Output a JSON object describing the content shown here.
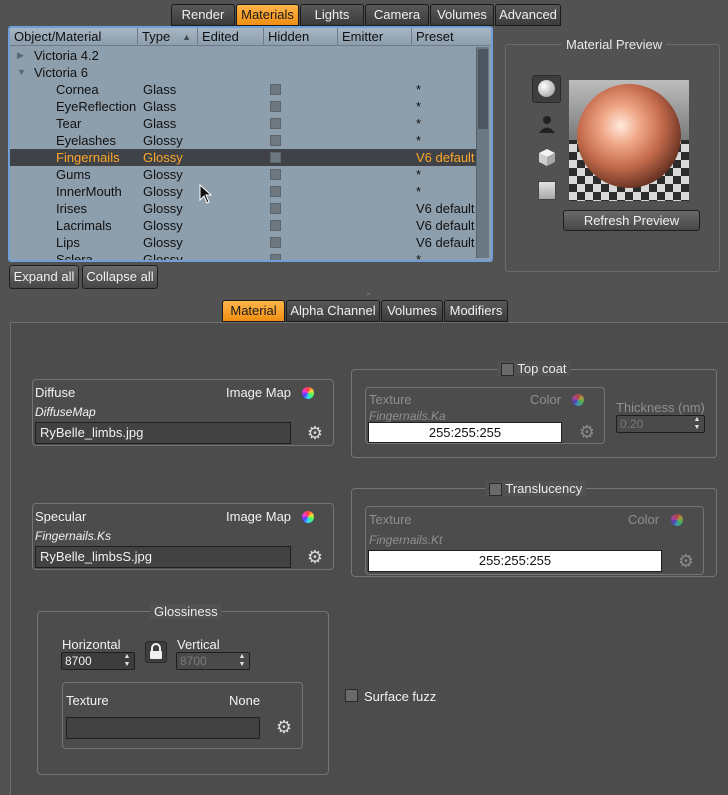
{
  "top_tabs": [
    "Render",
    "Materials",
    "Lights",
    "Camera",
    "Volumes",
    "Advanced"
  ],
  "tree": {
    "columns": [
      "Object/Material",
      "Type",
      "Edited",
      "Hidden",
      "Emitter",
      "Preset"
    ],
    "sort_indicator": "▲",
    "groups": [
      "Victoria 4.2",
      "Victoria 6"
    ],
    "rows": [
      {
        "name": "Cornea",
        "type": "Glass",
        "preset": "*"
      },
      {
        "name": "EyeReflection",
        "type": "Glass",
        "preset": "*"
      },
      {
        "name": "Tear",
        "type": "Glass",
        "preset": "*"
      },
      {
        "name": "Eyelashes",
        "type": "Glossy",
        "preset": "*"
      },
      {
        "name": "Fingernails",
        "type": "Glossy",
        "preset": "V6 default"
      },
      {
        "name": "Gums",
        "type": "Glossy",
        "preset": "*"
      },
      {
        "name": "InnerMouth",
        "type": "Glossy",
        "preset": "*"
      },
      {
        "name": "Irises",
        "type": "Glossy",
        "preset": "V6 default"
      },
      {
        "name": "Lacrimals",
        "type": "Glossy",
        "preset": "V6 default"
      },
      {
        "name": "Lips",
        "type": "Glossy",
        "preset": "V6 default"
      },
      {
        "name": "Sclera",
        "type": "Glossy",
        "preset": "*"
      }
    ]
  },
  "tree_buttons": {
    "expand": "Expand all",
    "collapse": "Collapse all"
  },
  "preview": {
    "title": "Material Preview",
    "refresh": "Refresh Preview"
  },
  "sub_tabs": [
    "Material",
    "Alpha Channel",
    "Volumes",
    "Modifiers"
  ],
  "diffuse": {
    "title": "Diffuse",
    "mode": "Image Map",
    "map_name": "DiffuseMap",
    "file": "RyBelle_limbs.jpg"
  },
  "specular": {
    "title": "Specular",
    "mode": "Image Map",
    "map_name": "Fingernails.Ks",
    "file": "RyBelle_limbsS.jpg"
  },
  "top_coat": {
    "title": "Top coat",
    "texture_label": "Texture",
    "mode": "Color",
    "map_name": "Fingernails.Ka",
    "color": "255:255:255",
    "thickness_label": "Thickness (nm)",
    "thickness": "0.20"
  },
  "translucency": {
    "title": "Translucency",
    "texture_label": "Texture",
    "mode": "Color",
    "map_name": "Fingernails.Kt",
    "color": "255:255:255"
  },
  "glossiness": {
    "title": "Glossiness",
    "horizontal_label": "Horizontal",
    "horizontal": "8700",
    "vertical_label": "Vertical",
    "vertical": "8700",
    "texture_label": "Texture",
    "texture_mode": "None",
    "texture_value": ""
  },
  "surface_fuzz": {
    "label": "Surface fuzz"
  },
  "colors": {
    "accent": "#f5a030",
    "selection_text": "#ffa52a",
    "tree_bg": "#8d9eac",
    "tree_border": "#6f9fd6"
  }
}
